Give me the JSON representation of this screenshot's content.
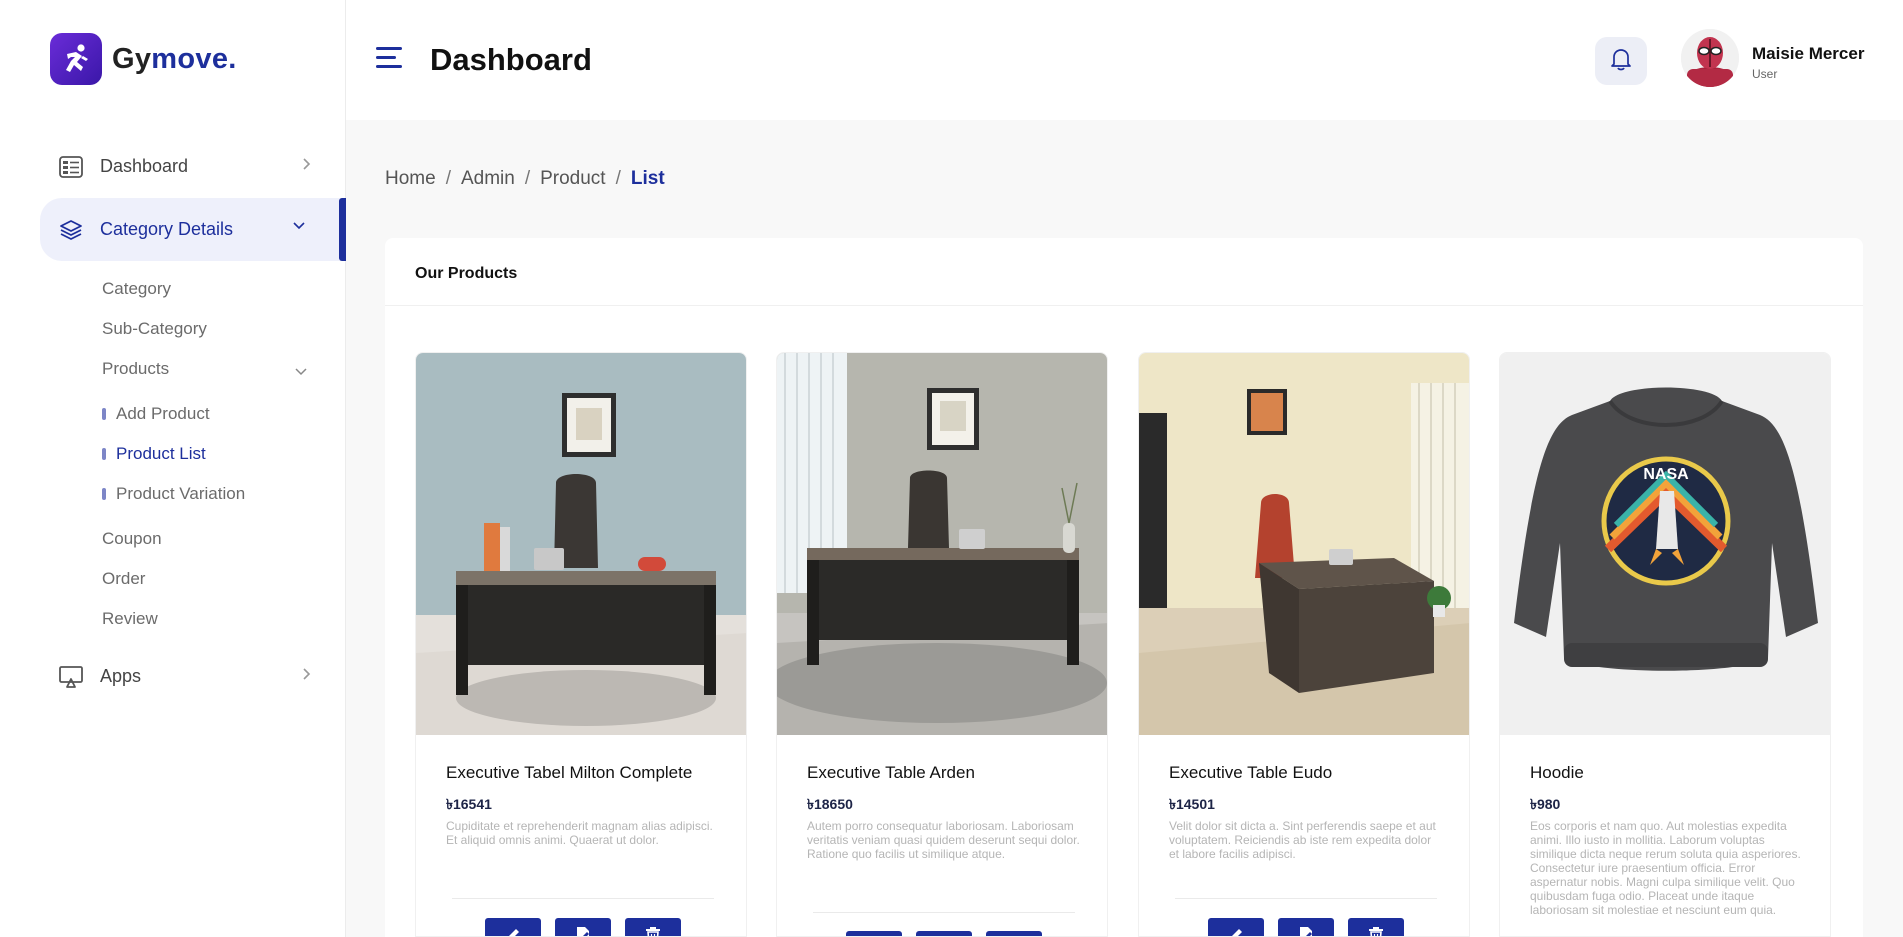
{
  "brand": {
    "name_part1": "Gy",
    "name_part2": "move.",
    "full": "Gymove."
  },
  "header": {
    "title": "Dashboard",
    "user_name": "Maisie Mercer",
    "user_role": "User"
  },
  "sidebar": {
    "items": [
      {
        "label": "Dashboard",
        "icon": "dashboard-icon"
      },
      {
        "label": "Category Details",
        "icon": "layers-icon",
        "active": true
      },
      {
        "label": "Apps",
        "icon": "monitor-icon"
      }
    ],
    "category_children": [
      "Category",
      "Sub-Category",
      "Products"
    ],
    "product_children": [
      "Add Product",
      "Product List",
      "Product Variation"
    ],
    "other_children": [
      "Coupon",
      "Order",
      "Review"
    ]
  },
  "breadcrumb": [
    "Home",
    "Admin",
    "Product",
    "List"
  ],
  "card": {
    "title": "Our Products"
  },
  "products": [
    {
      "name": "Executive Tabel Milton Complete",
      "price": "৳16541",
      "desc": "Cupiditate et reprehenderit magnam alias adipisci. Et aliquid omnis animi. Quaerat ut dolor."
    },
    {
      "name": "Executive Table Arden",
      "price": "৳18650",
      "desc": "Autem porro consequatur laboriosam. Laboriosam veritatis veniam quasi quidem deserunt sequi dolor. Ratione quo facilis ut similique atque."
    },
    {
      "name": "Executive Table Eudo",
      "price": "৳14501",
      "desc": "Velit dolor sit dicta a. Sint perferendis saepe et aut voluptatem. Reiciendis ab iste rem expedita dolor et labore facilis adipisci."
    },
    {
      "name": "Hoodie",
      "price": "৳980",
      "desc": "Eos corporis et nam quo. Aut molestias expedita animi. Illo iusto in mollitia. Laborum voluptas similique dicta neque rerum soluta quia asperiores. Consectetur iure praesentium officia. Error aspernatur nobis. Magni culpa similique velit. Quo quibusdam fuga odio. Placeat unde itaque laboriosam sit molestiae et nesciunt eum quia."
    }
  ],
  "hoodie_print": "NASA",
  "colors": {
    "accent": "#1d2f9c",
    "brand_purple": "#5b25cc"
  }
}
